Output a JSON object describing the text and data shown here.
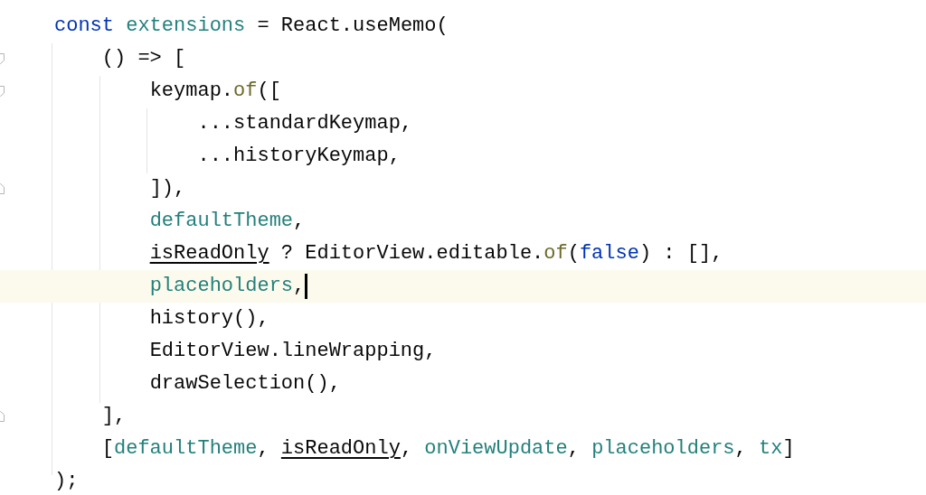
{
  "editor": {
    "lines": [
      {
        "kind": "code",
        "caret": false,
        "tokens": [
          {
            "text": "const",
            "kind": "keyword"
          },
          {
            "text": " extensions",
            "kind": "identifier"
          },
          {
            "text": " = React.useMemo(",
            "kind": "plain"
          }
        ]
      },
      {
        "kind": "fold-start",
        "caret": false,
        "tokens": [
          {
            "text": "    () => [",
            "kind": "plain"
          }
        ]
      },
      {
        "kind": "fold-start",
        "caret": false,
        "tokens": [
          {
            "text": "        keymap.",
            "kind": "plain"
          },
          {
            "text": "of",
            "kind": "function"
          },
          {
            "text": "([",
            "kind": "plain"
          }
        ]
      },
      {
        "kind": "code",
        "caret": false,
        "tokens": [
          {
            "text": "            ...standardKeymap,",
            "kind": "plain"
          }
        ]
      },
      {
        "kind": "code",
        "caret": false,
        "tokens": [
          {
            "text": "            ...historyKeymap,",
            "kind": "plain"
          }
        ]
      },
      {
        "kind": "fold-end",
        "caret": false,
        "tokens": [
          {
            "text": "        ]),",
            "kind": "plain"
          }
        ]
      },
      {
        "kind": "code",
        "caret": false,
        "tokens": [
          {
            "text": "        defaultTheme",
            "kind": "identifier"
          },
          {
            "text": ",",
            "kind": "plain"
          }
        ]
      },
      {
        "kind": "code",
        "caret": false,
        "tokens": [
          {
            "text": "        isReadOnly",
            "kind": "parameter"
          },
          {
            "text": " ? EditorView.editable.",
            "kind": "plain"
          },
          {
            "text": "of",
            "kind": "function"
          },
          {
            "text": "(",
            "kind": "plain"
          },
          {
            "text": "false",
            "kind": "keyword"
          },
          {
            "text": ") : [],",
            "kind": "plain"
          }
        ]
      },
      {
        "kind": "code",
        "caret": true,
        "tokens": [
          {
            "text": "        placeholders",
            "kind": "identifier"
          },
          {
            "text": ",",
            "kind": "plain"
          }
        ]
      },
      {
        "kind": "code",
        "caret": false,
        "tokens": [
          {
            "text": "        history(),",
            "kind": "plain"
          }
        ]
      },
      {
        "kind": "code",
        "caret": false,
        "tokens": [
          {
            "text": "        EditorView.lineWrapping,",
            "kind": "plain"
          }
        ]
      },
      {
        "kind": "code",
        "caret": false,
        "tokens": [
          {
            "text": "        drawSelection(),",
            "kind": "plain"
          }
        ]
      },
      {
        "kind": "fold-end",
        "caret": false,
        "tokens": [
          {
            "text": "    ],",
            "kind": "plain"
          }
        ]
      },
      {
        "kind": "code",
        "caret": false,
        "tokens": [
          {
            "text": "    [",
            "kind": "plain"
          },
          {
            "text": "defaultTheme",
            "kind": "identifier"
          },
          {
            "text": ", ",
            "kind": "plain"
          },
          {
            "text": "isReadOnly",
            "kind": "parameter"
          },
          {
            "text": ", ",
            "kind": "plain"
          },
          {
            "text": "onViewUpdate",
            "kind": "identifier"
          },
          {
            "text": ", ",
            "kind": "plain"
          },
          {
            "text": "placeholders",
            "kind": "identifier"
          },
          {
            "text": ", ",
            "kind": "plain"
          },
          {
            "text": "tx",
            "kind": "identifier"
          },
          {
            "text": "]",
            "kind": "plain"
          }
        ]
      },
      {
        "kind": "code",
        "caret": false,
        "tokens": [
          {
            "text": ");",
            "kind": "plain"
          }
        ]
      }
    ]
  }
}
